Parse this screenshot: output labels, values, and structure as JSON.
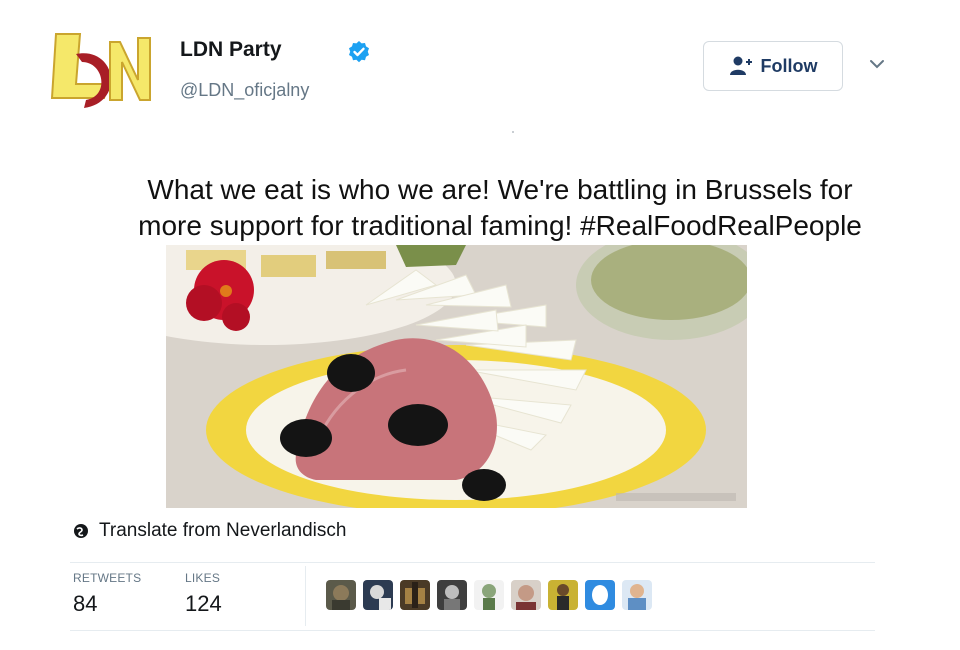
{
  "header": {
    "logo_text": "LDN",
    "display_name": "LDN Party",
    "handle": "@LDN_oficjalny",
    "follow_label": "Follow"
  },
  "tweet": {
    "text_line1": "What we eat is who we are!  We're battling in Brussels for",
    "text_line2": "more support for traditional faming! #RealFoodRealPeople"
  },
  "translate_label": "Translate from Neverlandisch",
  "stats": {
    "retweets_label": "RETWEETS",
    "retweets_value": "84",
    "likes_label": "LIKES",
    "likes_value": "124"
  },
  "liker_avatars": [
    {
      "icon": "avatar-1",
      "color": "#5b5a4a"
    },
    {
      "icon": "avatar-2",
      "color": "#2c3b52"
    },
    {
      "icon": "avatar-3",
      "color": "#4a3a26"
    },
    {
      "icon": "avatar-4",
      "color": "#3e3e3e"
    },
    {
      "icon": "avatar-5",
      "color": "#8aa57a"
    },
    {
      "icon": "avatar-6",
      "color": "#c49a86"
    },
    {
      "icon": "avatar-7",
      "color": "#c9b233"
    },
    {
      "icon": "avatar-8",
      "color": "#2f8be0"
    },
    {
      "icon": "avatar-9",
      "color": "#5e8fc4"
    }
  ],
  "colors": {
    "verified": "#1da1f2",
    "follow_text": "#1f3b64",
    "logo_yellow": "#f5e86a",
    "logo_red": "#a81e26"
  }
}
